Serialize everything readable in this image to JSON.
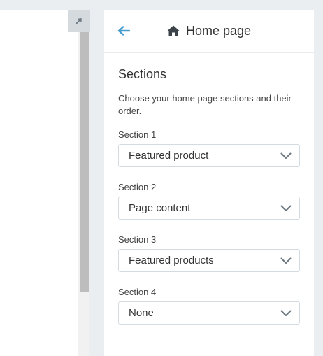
{
  "header": {
    "title": "Home page",
    "back_icon": "arrow-left-icon",
    "title_icon": "home-icon"
  },
  "sections_panel": {
    "heading": "Sections",
    "description": "Choose your home page sections and their order.",
    "fields": [
      {
        "label": "Section 1",
        "value": "Featured product"
      },
      {
        "label": "Section 2",
        "value": "Page content"
      },
      {
        "label": "Section 3",
        "value": "Featured products"
      },
      {
        "label": "Section 4",
        "value": "None"
      }
    ]
  },
  "colors": {
    "accent": "#479ccf",
    "background": "#ebeef0",
    "panel": "#ffffff",
    "border": "#d3dbe2"
  }
}
